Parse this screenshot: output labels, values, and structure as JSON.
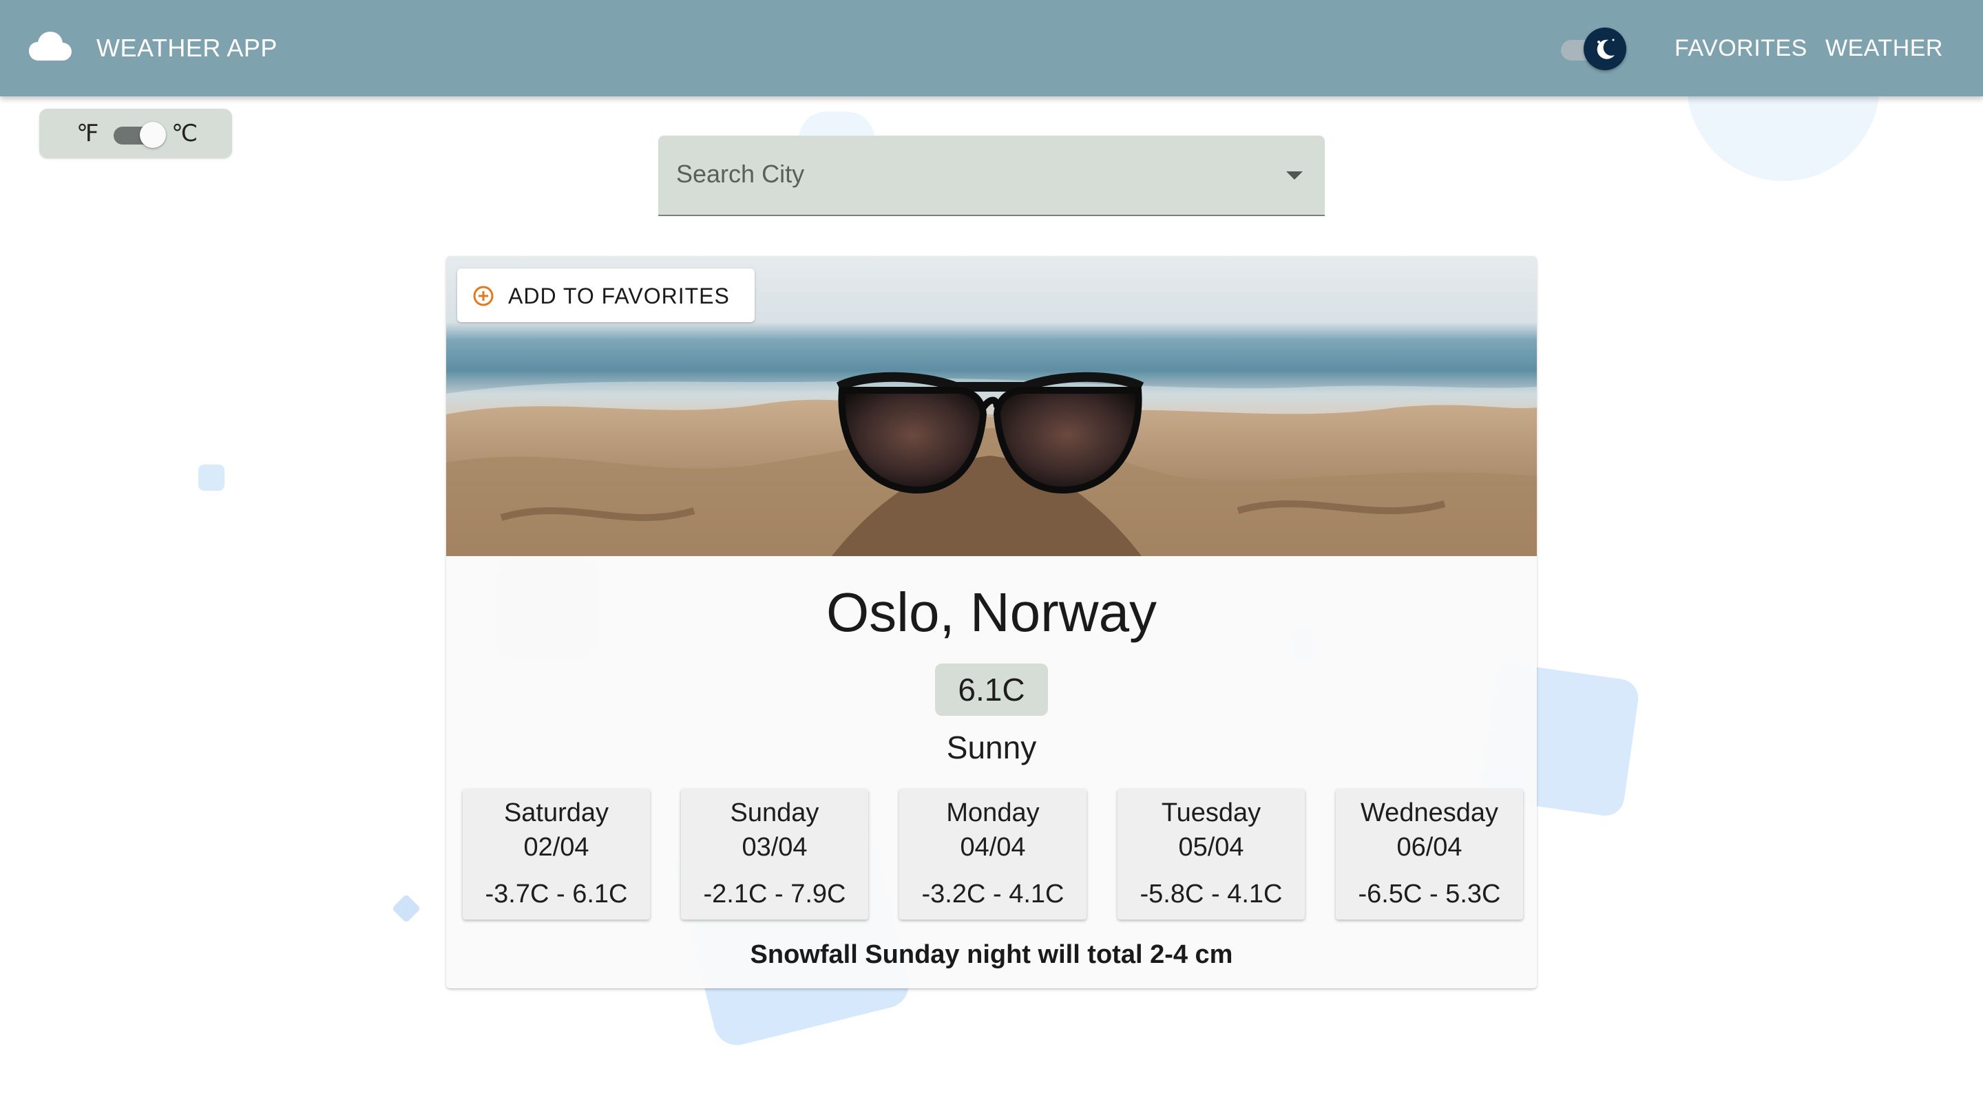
{
  "header": {
    "brand_icon": "cloud-icon",
    "title": "WEATHER APP",
    "theme_toggle_icon": "moon-icon",
    "nav": [
      {
        "label": "FAVORITES"
      },
      {
        "label": "WEATHER"
      }
    ],
    "colors": {
      "appbar": "#7ea2ae",
      "theme_thumb": "#0b2a47"
    }
  },
  "unit_toggle": {
    "fahrenheit_label": "℉",
    "celsius_label": "℃",
    "selected": "celsius"
  },
  "search": {
    "placeholder": "Search City",
    "value": "",
    "dropdown_icon": "chevron-down-icon"
  },
  "card": {
    "banner_image": "beach-sunglasses-photo",
    "add_favorite_icon": "plus-circle-icon",
    "add_favorite_label": "ADD TO FAVORITES",
    "city": "Oslo, Norway",
    "temperature": "6.1C",
    "condition": "Sunny",
    "forecast": [
      {
        "day": "Saturday",
        "date": "02/04",
        "range": "-3.7C - 6.1C"
      },
      {
        "day": "Sunday",
        "date": "03/04",
        "range": "-2.1C - 7.9C"
      },
      {
        "day": "Monday",
        "date": "04/04",
        "range": "-3.2C - 4.1C"
      },
      {
        "day": "Tuesday",
        "date": "05/04",
        "range": "-5.8C - 4.1C"
      },
      {
        "day": "Wednesday",
        "date": "06/04",
        "range": "-6.5C - 5.3C"
      }
    ],
    "note": "Snowfall Sunday night will total 2-4 cm",
    "colors": {
      "accent": "#e07a1f",
      "badge": "#d6dcd6"
    }
  }
}
